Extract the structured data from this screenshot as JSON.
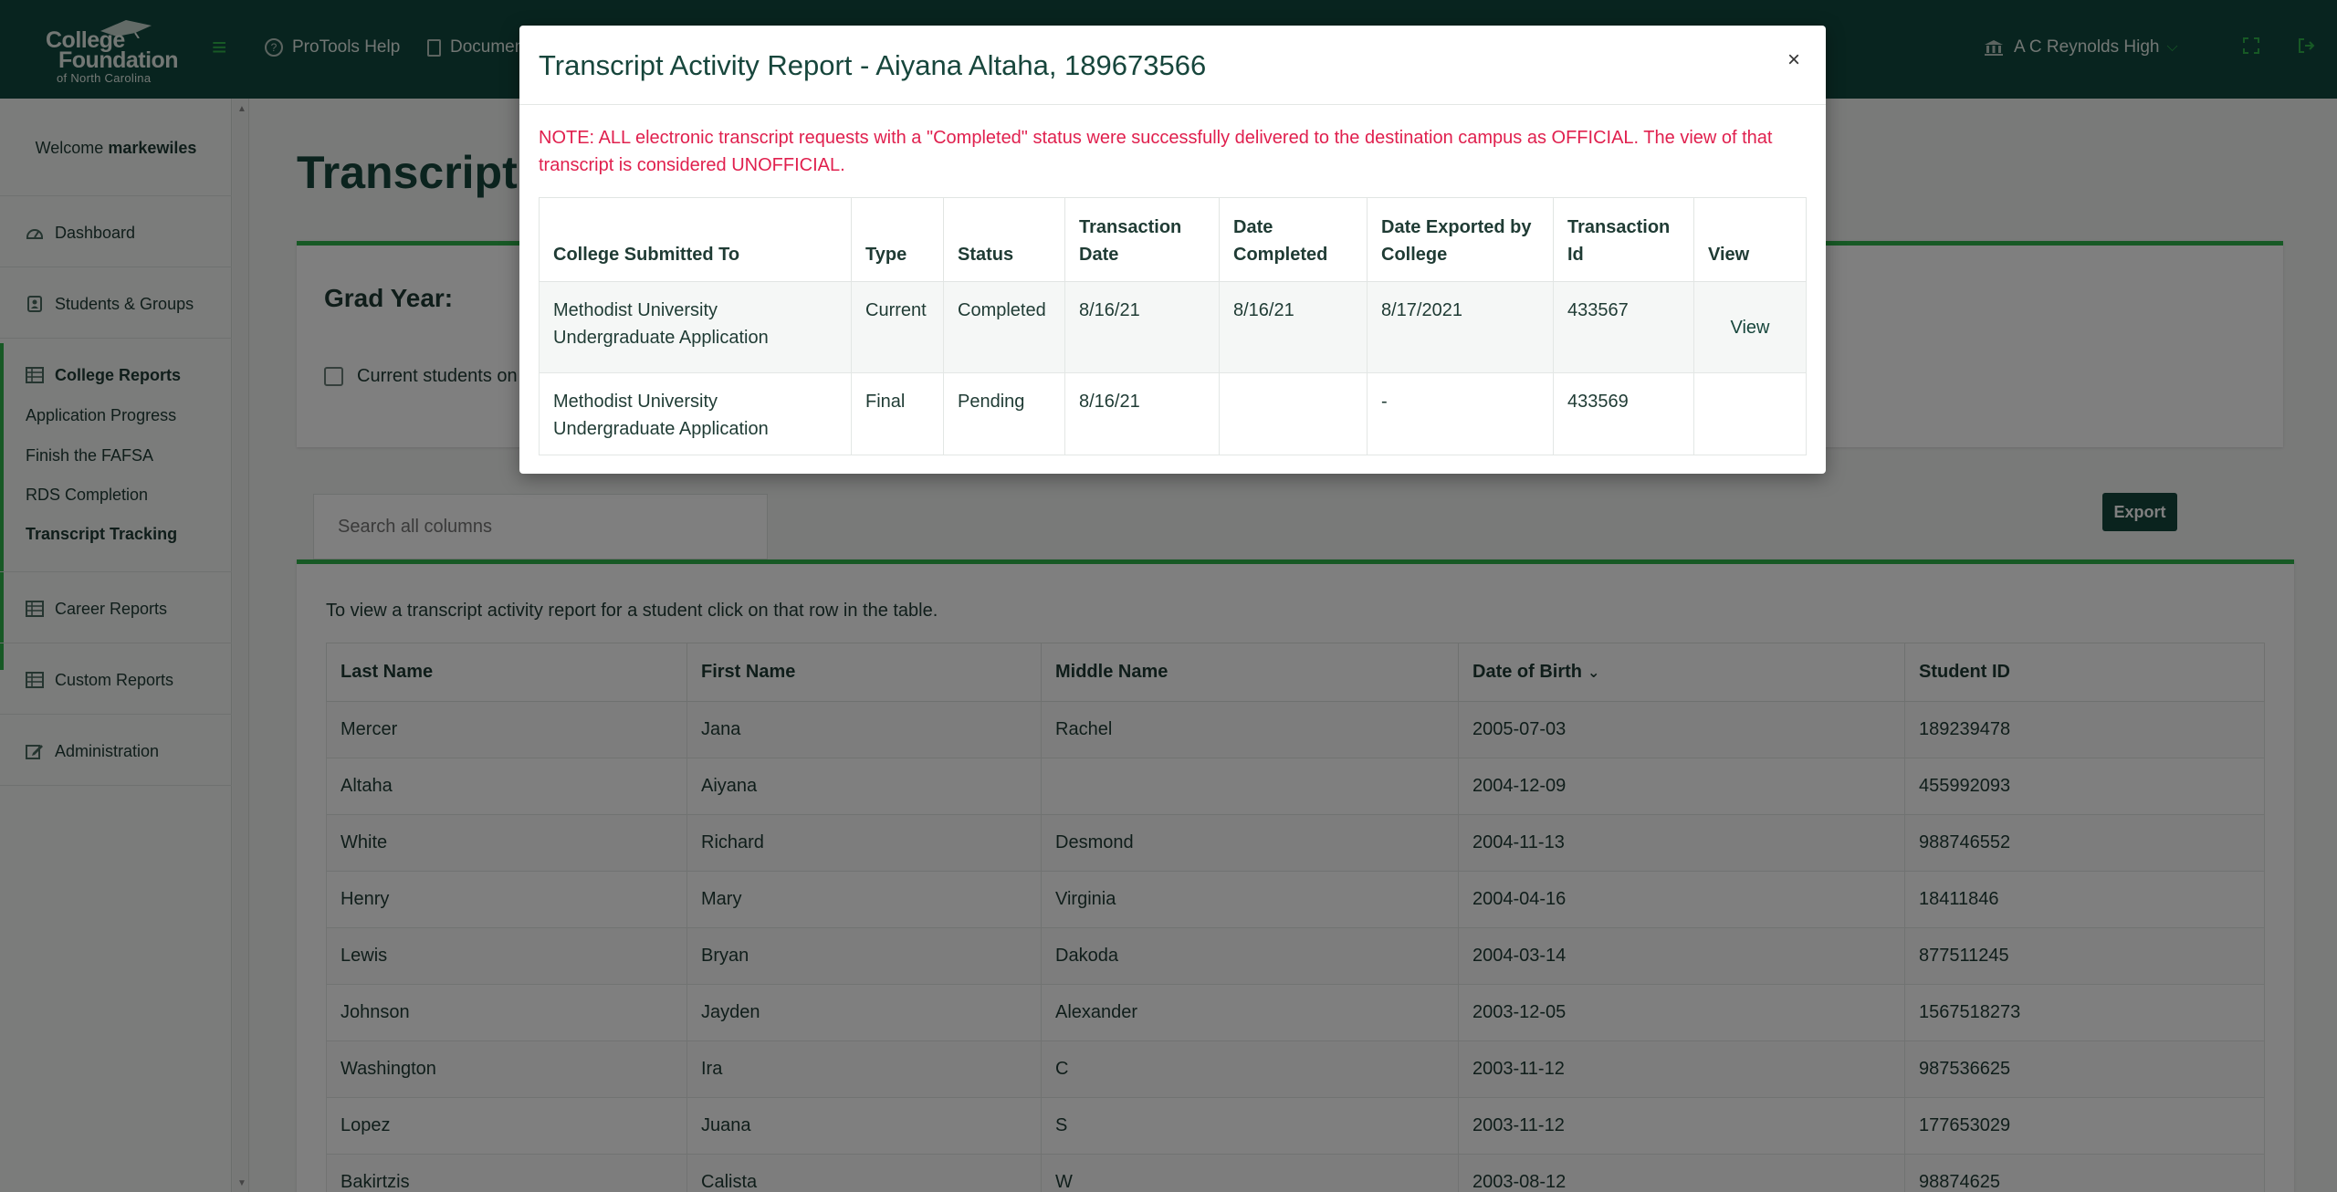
{
  "topbar": {
    "logo_line1": "College",
    "logo_line2": "Foundation",
    "logo_line3": "of North Carolina",
    "nav_help": "ProTools Help",
    "nav_docs": "Documen",
    "school_name": "A C Reynolds High"
  },
  "sidebar": {
    "welcome_prefix": "Welcome",
    "username": "markewiles",
    "items": {
      "dashboard": "Dashboard",
      "students_groups": "Students & Groups",
      "college_reports": "College Reports",
      "application_progress": "Application Progress",
      "finish_fafsa": "Finish the FAFSA",
      "rds_completion": "RDS Completion",
      "transcript_tracking": "Transcript Tracking",
      "career_reports": "Career Reports",
      "custom_reports": "Custom Reports",
      "administration": "Administration"
    }
  },
  "main": {
    "title": "Transcript T",
    "grad_year_label": "Grad Year:",
    "current_students_label": "Current students on",
    "search_placeholder": "Search all columns",
    "export_label": "Export",
    "table_note": "To view a transcript activity report for a student click on that row in the table.",
    "columns": [
      "Last Name",
      "First Name",
      "Middle Name",
      "Date of Birth",
      "Student ID"
    ],
    "rows": [
      [
        "Mercer",
        "Jana",
        "Rachel",
        "2005-07-03",
        "189239478"
      ],
      [
        "Altaha",
        "Aiyana",
        "",
        "2004-12-09",
        "455992093"
      ],
      [
        "White",
        "Richard",
        "Desmond",
        "2004-11-13",
        "988746552"
      ],
      [
        "Henry",
        "Mary",
        "Virginia",
        "2004-04-16",
        "18411846"
      ],
      [
        "Lewis",
        "Bryan",
        "Dakoda",
        "2004-03-14",
        "877511245"
      ],
      [
        "Johnson",
        "Jayden",
        "Alexander",
        "2003-12-05",
        "1567518273"
      ],
      [
        "Washington",
        "Ira",
        "C",
        "2003-11-12",
        "987536625"
      ],
      [
        "Lopez",
        "Juana",
        "S",
        "2003-11-12",
        "177653029"
      ],
      [
        "Bakirtzis",
        "Calista",
        "W",
        "2003-08-12",
        "98874625"
      ]
    ]
  },
  "modal": {
    "title": "Transcript Activity Report - Aiyana Altaha, 189673566",
    "close_label": "×",
    "note": "NOTE: ALL electronic transcript requests with a \"Completed\" status were successfully delivered to the destination campus as OFFICIAL. The view of that transcript is considered UNOFFICIAL.",
    "columns": {
      "college": "College Submitted To",
      "type": "Type",
      "status": "Status",
      "transaction_date": "Transaction Date",
      "date_completed": "Date Completed",
      "date_exported": "Date Exported by College",
      "transaction_id": "Transaction Id",
      "view": "View"
    },
    "rows": [
      {
        "college": "Methodist University Undergraduate Application",
        "type": "Current",
        "status": "Completed",
        "transaction_date": "8/16/21",
        "date_completed": "8/16/21",
        "date_exported": "8/17/2021",
        "transaction_id": "433567",
        "view": "View"
      },
      {
        "college": "Methodist University Undergraduate Application",
        "type": "Final",
        "status": "Pending",
        "transaction_date": "8/16/21",
        "date_completed": "",
        "date_exported": "-",
        "transaction_id": "433569",
        "view": ""
      }
    ]
  },
  "colors": {
    "header_bg": "#11493f",
    "accent_green": "#2eb24b",
    "note_red": "#e0204e",
    "dark_text": "#17463c"
  }
}
